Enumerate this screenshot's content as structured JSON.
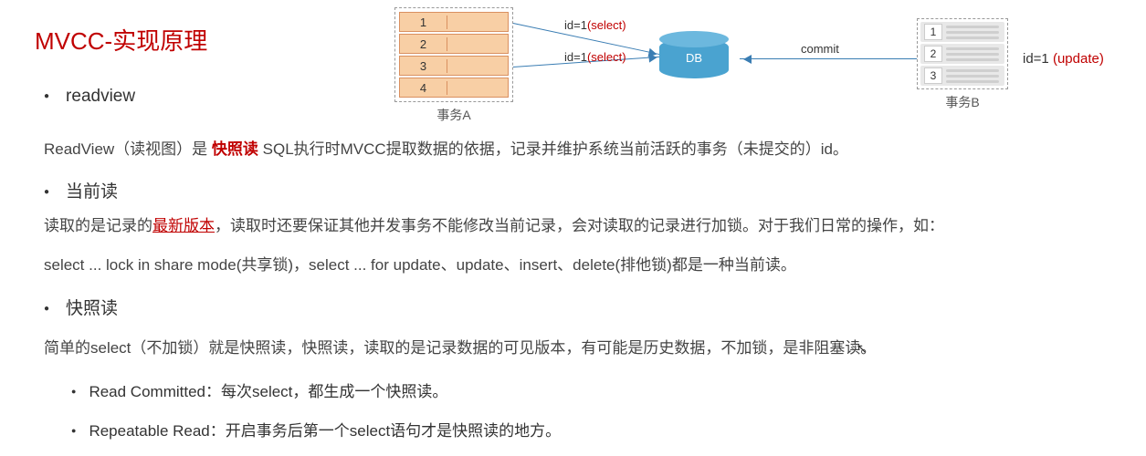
{
  "title": "MVCC-实现原理",
  "sections": {
    "readview": {
      "heading": "readview",
      "text_pre": "ReadView（读视图）是 ",
      "text_em": "快照读",
      "text_post": " SQL执行时MVCC提取数据的依据，记录并维护系统当前活跃的事务（未提交的）id。"
    },
    "current_read": {
      "heading": "当前读",
      "line1_pre": "读取的是记录的",
      "line1_em": "最新版本",
      "line1_post": "，读取时还要保证其他并发事务不能修改当前记录，会对读取的记录进行加锁。对于我们日常的操作，如：",
      "line2": "select ... lock in share mode(共享锁)，select ... for update、update、insert、delete(排他锁)都是一种当前读。"
    },
    "snapshot_read": {
      "heading": "快照读",
      "line1": "简单的select（不加锁）就是快照读，快照读，读取的是记录数据的可见版本，有可能是历史数据，不加锁，是非阻塞读。",
      "sub1": "Read Committed：每次select，都生成一个快照读。",
      "sub2": "Repeatable Read：开启事务后第一个select语句才是快照读的地方。"
    }
  },
  "diagram": {
    "txA": {
      "label": "事务A",
      "rows": [
        "1",
        "2",
        "3",
        "4"
      ]
    },
    "edge1_pre": "id=1",
    "edge1_suf": "(select)",
    "edge2_pre": "id=1",
    "edge2_suf": "(select)",
    "db_label": "DB",
    "commit_label": "commit",
    "txB": {
      "label": "事务B",
      "rows": [
        "1",
        "2",
        "3"
      ]
    },
    "update_pre": "id=1 ",
    "update_suf": "(update)"
  }
}
